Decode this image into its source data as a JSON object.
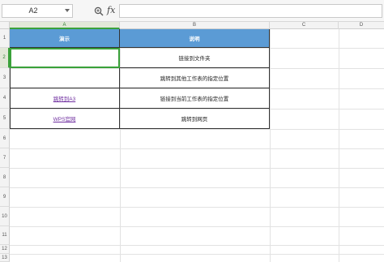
{
  "formula_bar": {
    "cell_reference": "A2",
    "zoom_icon": "zoom-icon",
    "fx_label": "fx",
    "formula_value": ""
  },
  "columns": [
    "A",
    "B",
    "C",
    "D"
  ],
  "rows": [
    "1",
    "2",
    "3",
    "4",
    "5",
    "6",
    "7",
    "8",
    "9",
    "10",
    "11",
    "12",
    "13"
  ],
  "table": {
    "headers": [
      "演示",
      "说明"
    ],
    "rows": [
      {
        "demo": "",
        "description": "链接到文件夹"
      },
      {
        "demo": "",
        "description": "跳转到其他工作表的指定位置"
      },
      {
        "demo": "跳转到A3",
        "description": "链接到当前工作表的指定位置"
      },
      {
        "demo": "WPS官网",
        "description": "跳转到网页"
      }
    ]
  },
  "selection": {
    "cell": "A2"
  },
  "colors": {
    "header_fill": "#5b9bd5",
    "header_text": "#ffffff",
    "link_text": "#7030a0",
    "selection_border": "#3aa13a"
  }
}
